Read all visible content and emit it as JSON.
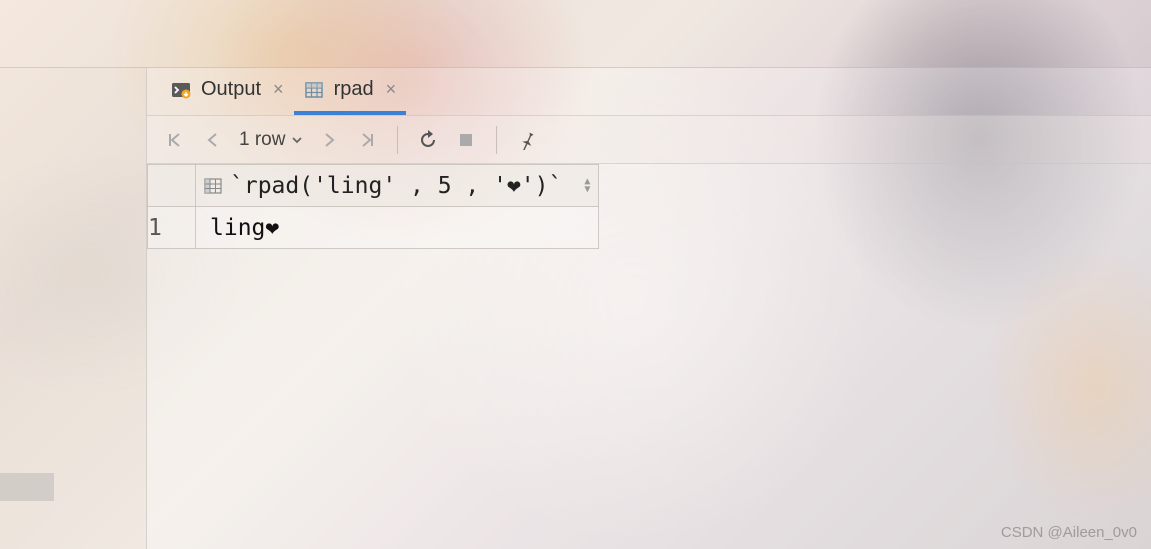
{
  "tabs": [
    {
      "label": "Output",
      "icon": "console-icon",
      "active": false
    },
    {
      "label": "rpad",
      "icon": "table-icon",
      "active": true
    }
  ],
  "toolbar": {
    "row_count_label": "1 row"
  },
  "table": {
    "column_header": "`rpad('ling' , 5 , '❤')`",
    "rows": [
      {
        "num": "1",
        "value": "ling❤"
      }
    ]
  },
  "watermark": "CSDN @Aileen_0v0"
}
